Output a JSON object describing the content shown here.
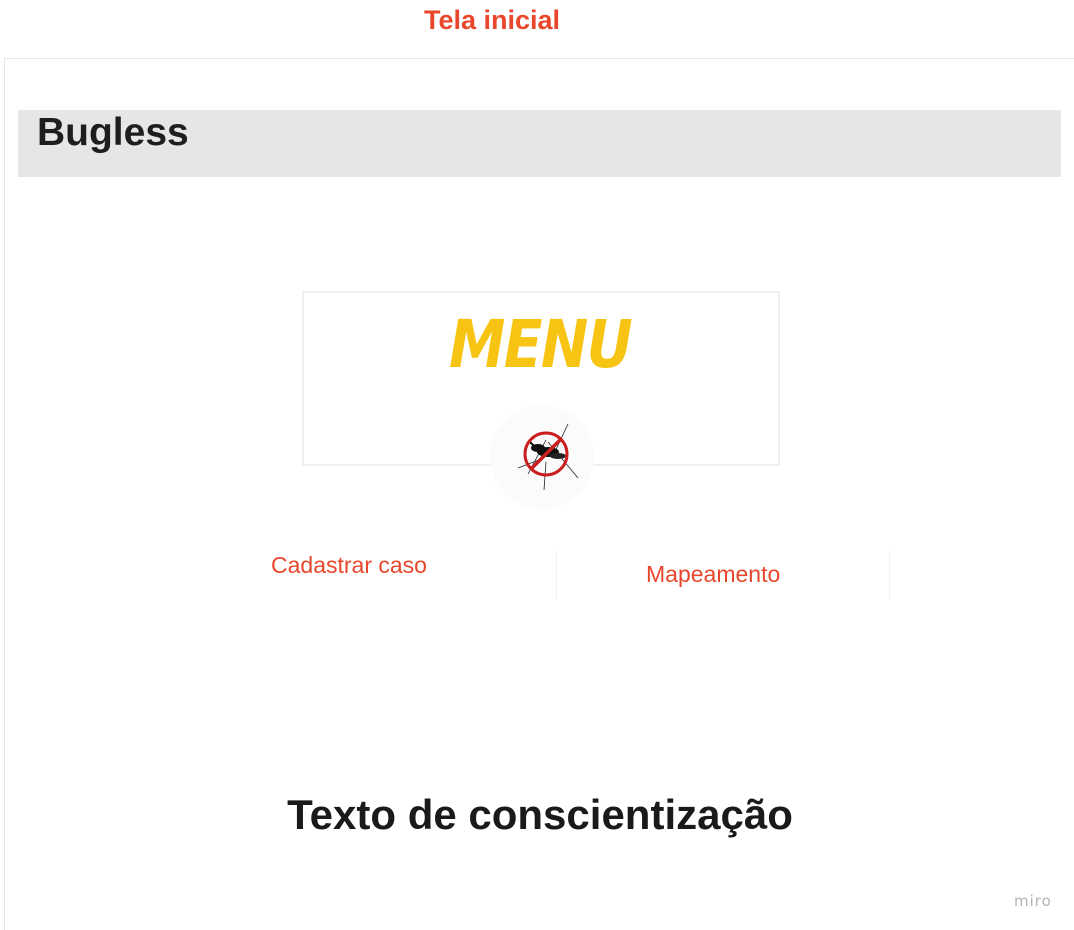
{
  "frame": {
    "title": "Tela inicial"
  },
  "header": {
    "app_name": "Bugless"
  },
  "menu": {
    "title": "MENU",
    "logo_icon": "mosquito-prohibited-icon",
    "title_color": "#f8c413"
  },
  "nav": {
    "items": [
      {
        "label": "Cadastrar caso"
      },
      {
        "label": "Mapeamento"
      }
    ]
  },
  "content": {
    "awareness_text": "Texto de conscientização"
  },
  "watermark": {
    "text": "miro"
  },
  "colors": {
    "accent": "#e8472c",
    "header_bg": "#e6e6e6",
    "menu_yellow": "#f8c413"
  }
}
